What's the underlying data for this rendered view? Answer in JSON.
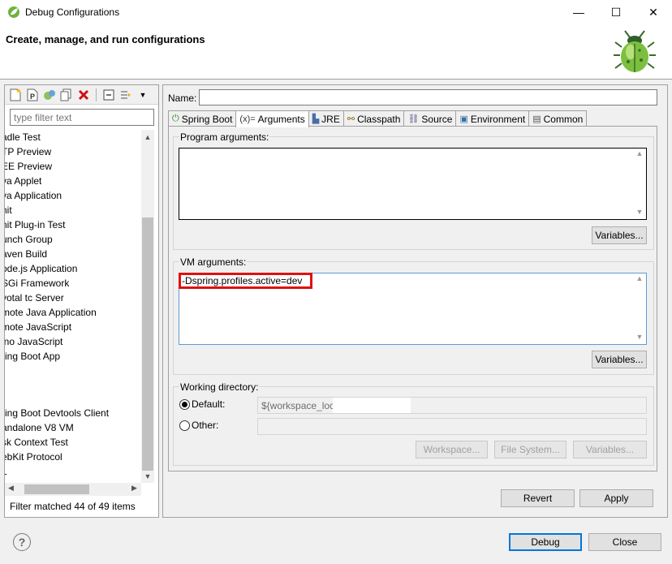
{
  "window": {
    "title": "Debug Configurations",
    "min_glyph": "—",
    "max_glyph": "☐",
    "close_glyph": "✕"
  },
  "banner": {
    "title": "Create, manage, and run configurations"
  },
  "left": {
    "filter_placeholder": "type filter text",
    "items_top": [
      "adle Test",
      "TP Preview",
      "EE Preview",
      "va Applet",
      "va Application",
      "nit",
      "nit Plug-in Test",
      "unch Group",
      "aven Build",
      "ode.js Application",
      "SGi Framework",
      "votal tc Server",
      "mote Java Application",
      "mote JavaScript",
      "ino JavaScript",
      "ring Boot App"
    ],
    "items_bottom": [
      "ring Boot Devtools Client",
      "andalone V8 VM",
      "sk Context Test",
      "ebKit Protocol",
      "L"
    ],
    "filter_status": "Filter matched 44 of 49 items"
  },
  "right": {
    "name_label": "Name:",
    "name_value": "",
    "tabs": [
      {
        "label": "Spring Boot",
        "icon": "power-icon",
        "glyph": "⏻",
        "color": "#2e8b2e"
      },
      {
        "label": "Arguments",
        "icon": "arguments-icon",
        "glyph": "(x)=",
        "color": "#333333"
      },
      {
        "label": "JRE",
        "icon": "jre-icon",
        "glyph": "▙",
        "color": "#4a6da7"
      },
      {
        "label": "Classpath",
        "icon": "classpath-icon",
        "glyph": "⚯",
        "color": "#8a6a00"
      },
      {
        "label": "Source",
        "icon": "source-icon",
        "glyph": "⛓",
        "color": "#5a5a8a"
      },
      {
        "label": "Environment",
        "icon": "environment-icon",
        "glyph": "▣",
        "color": "#3a6ea5"
      },
      {
        "label": "Common",
        "icon": "common-icon",
        "glyph": "▤",
        "color": "#555555"
      }
    ],
    "active_tab": "Arguments",
    "program_args_label": "Program arguments:",
    "program_args_value": "",
    "variables_label": "Variables...",
    "vm_args_label": "VM arguments:",
    "vm_args_value": "-Dspring.profiles.active=dev",
    "working_dir_label": "Working directory:",
    "default_label": "Default:",
    "default_value": "${workspace_loc",
    "other_label": "Other:",
    "workspace_label": "Workspace...",
    "filesystem_label": "File System...",
    "wd_variables_label": "Variables...",
    "revert_label": "Revert",
    "apply_label": "Apply"
  },
  "footer": {
    "debug_label": "Debug",
    "close_label": "Close",
    "help_glyph": "?"
  },
  "colors": {
    "highlight": "#e01010",
    "focus": "#0078d7"
  }
}
